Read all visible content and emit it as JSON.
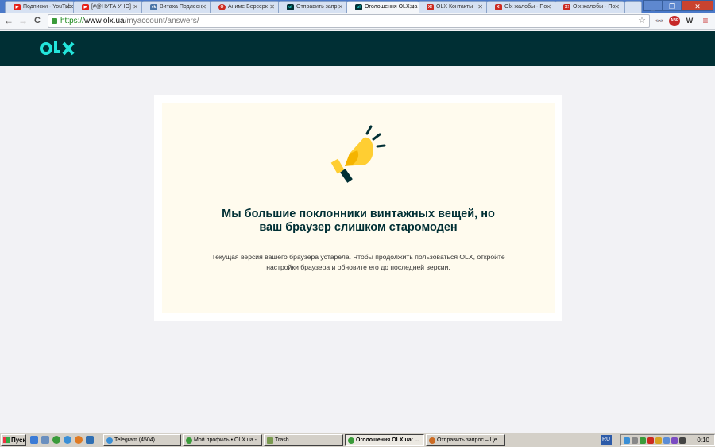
{
  "browser": {
    "tabs": [
      {
        "label": "Подписки - YouTube",
        "favicon": "youtube-icon",
        "color": "#e62117",
        "active": false
      },
      {
        "label": "[#@НУТА УНО]",
        "favicon": "youtube-icon",
        "color": "#e62117",
        "active": false
      },
      {
        "label": "Витаха Подлесн",
        "favicon": "vk-icon",
        "color": "#4a76a8",
        "active": false
      },
      {
        "label": "Аниме Берсерк",
        "favicon": "opera-icon",
        "color": "#cc2a20",
        "active": false
      },
      {
        "label": "Отправить запр",
        "favicon": "olx-icon",
        "color": "#23e5db",
        "active": false
      },
      {
        "label": "Оголошення OLX.ua",
        "favicon": "olx-icon",
        "color": "#23e5db",
        "active": true
      },
      {
        "label": "OLX Контакты",
        "favicon": "x-icon",
        "color": "#cc2a20",
        "active": false
      },
      {
        "label": "Olx жалобы - По",
        "favicon": "x-icon",
        "color": "#cc2a20",
        "active": false
      },
      {
        "label": "Olx жалобы - По",
        "favicon": "x-icon",
        "color": "#cc2a20",
        "active": false
      }
    ],
    "window_controls": {
      "minimize": "_",
      "maximize": "❐",
      "close": "✕"
    },
    "nav": {
      "back": "←",
      "forward": "→",
      "reload": "C"
    },
    "url": {
      "scheme": "https://",
      "host": "www.olx.ua",
      "path": "/myaccount/answers/"
    },
    "star_icon": "☆",
    "extensions": [
      {
        "name": "glasses-icon",
        "glyph": "👓"
      },
      {
        "name": "abp-icon",
        "glyph": "ABP"
      },
      {
        "name": "w-icon",
        "glyph": "W"
      },
      {
        "name": "menu-icon",
        "glyph": "≡"
      }
    ]
  },
  "site": {
    "logo": "OLX",
    "brand_color": "#23e5db",
    "header_color": "#002f34"
  },
  "message": {
    "title_line1": "Мы большие поклонники винтажных вещей, но",
    "title_line2": "ваш браузер слишком старомоден",
    "desc_line1": "Текущая версия вашего браузера устарела. Чтобы продолжить пользоваться OLX, откройте",
    "desc_line2": "настройки браузера и обновите его до последней версии.",
    "illustration": "megaphone-icon"
  },
  "taskbar": {
    "start_label": "Пуск",
    "tasks": [
      {
        "label": "Telegram (4504)",
        "color": "#3a8fd6",
        "active": false
      },
      {
        "label": "Мой профиль • OLX.ua -...",
        "color": "#3a9b3a",
        "active": false
      },
      {
        "label": "Trash",
        "color": "#7a9a50",
        "active": false
      },
      {
        "label": "Оголошення OLX.ua: ...",
        "color": "#3a9b3a",
        "active": true
      },
      {
        "label": "Отправить запрос – Це...",
        "color": "#cc6b23",
        "active": false
      }
    ],
    "language": "RU",
    "clock": "0:10"
  }
}
